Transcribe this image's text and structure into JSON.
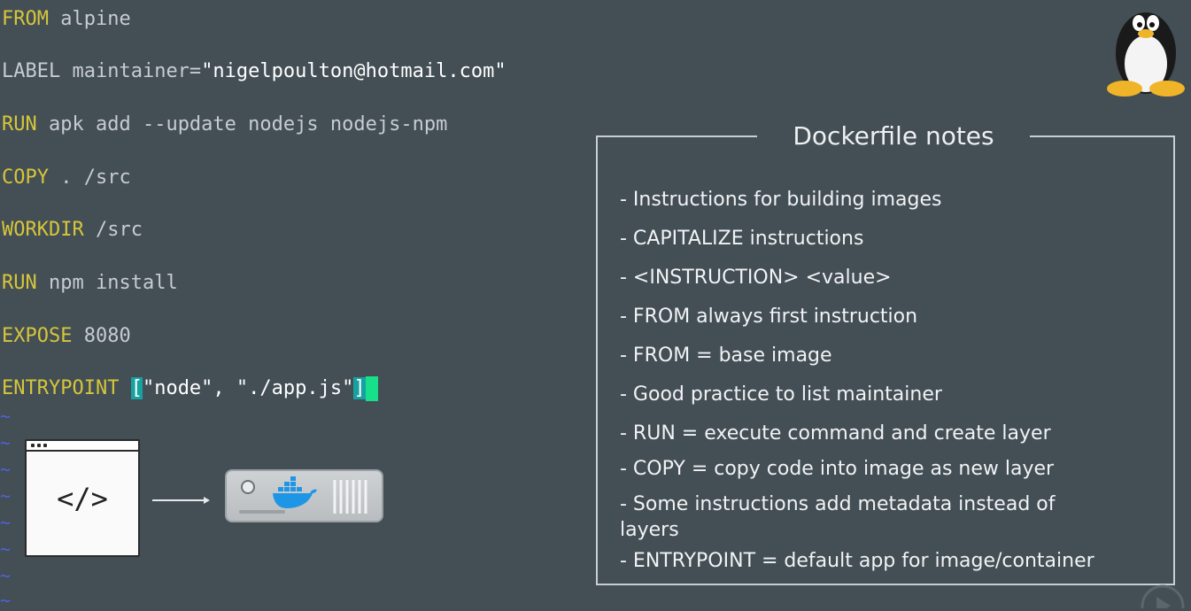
{
  "code": {
    "lines": [
      {
        "keyword": "FROM",
        "rest": " alpine"
      },
      {
        "keyword": "LABEL",
        "rest": " maintainer=",
        "string": "\"nigelpoulton@hotmail.com\""
      },
      {
        "keyword": "RUN",
        "rest": " apk add --update nodejs nodejs-npm"
      },
      {
        "keyword": "COPY",
        "rest": " . /src"
      },
      {
        "keyword": "WORKDIR",
        "rest": " /src"
      },
      {
        "keyword": "RUN",
        "rest": " npm install"
      },
      {
        "keyword": "EXPOSE",
        "rest": " 8080"
      },
      {
        "keyword": "ENTRYPOINT",
        "rest": " ",
        "open_bracket": "[",
        "string": "\"node\", \"./app.js\"",
        "close_bracket": "]"
      }
    ],
    "tilde": "~"
  },
  "diagram": {
    "code_symbol": "</>",
    "icons": [
      "code-window-icon",
      "arrow-icon",
      "docker-server-icon"
    ]
  },
  "notes": {
    "title": "Dockerfile notes",
    "items": [
      "- Instructions for building images",
      "- CAPITALIZE instructions",
      "- <INSTRUCTION> <value>",
      "- FROM always first instruction",
      "- FROM = base image",
      "- Good practice to list maintainer",
      "- RUN = execute command and create layer",
      "- COPY = copy code into image as new layer",
      "- Some instructions add metadata instead of layers",
      "- ENTRYPOINT = default app for image/container"
    ]
  },
  "colors": {
    "background": "#434e55",
    "keyword": "#d6c63a",
    "text": "#c7ccd0",
    "string": "#ffffff",
    "tilde": "#4f63d8",
    "bracket_highlight": "#17a2a2",
    "cursor": "#18e08a"
  }
}
